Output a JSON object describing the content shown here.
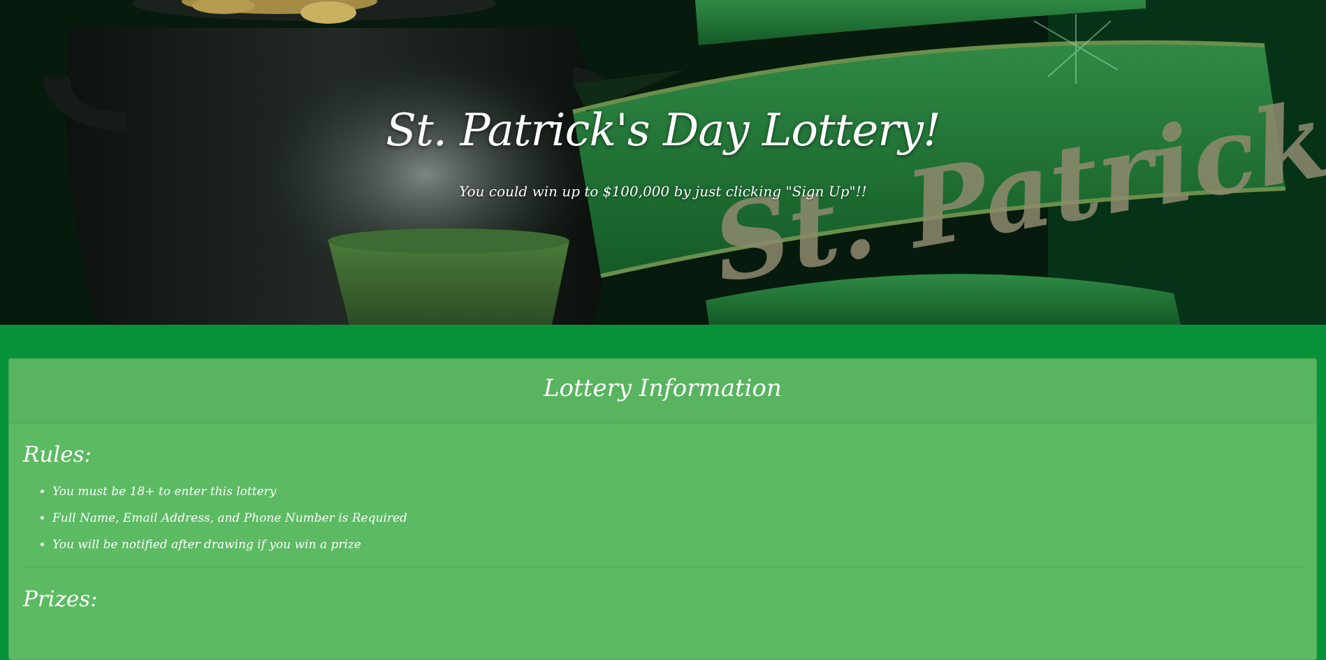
{
  "hero": {
    "title": "St. Patrick's Day Lottery!",
    "subtitle": "You could win up to $100,000 by just clicking \"Sign Up\"!!",
    "banner_text": "St. Patrick's"
  },
  "panel": {
    "title": "Lottery Information",
    "rules_heading": "Rules:",
    "rules": [
      "You must be 18+ to enter this lottery",
      "Full Name, Email Address, and Phone Number is Required",
      "You will be notified after drawing if you win a prize"
    ],
    "prizes_heading": "Prizes:"
  },
  "colors": {
    "page_background": "#08933a",
    "panel_background": "#5cba63",
    "panel_heading_background": "#58b45f",
    "text": "#ffffff"
  }
}
